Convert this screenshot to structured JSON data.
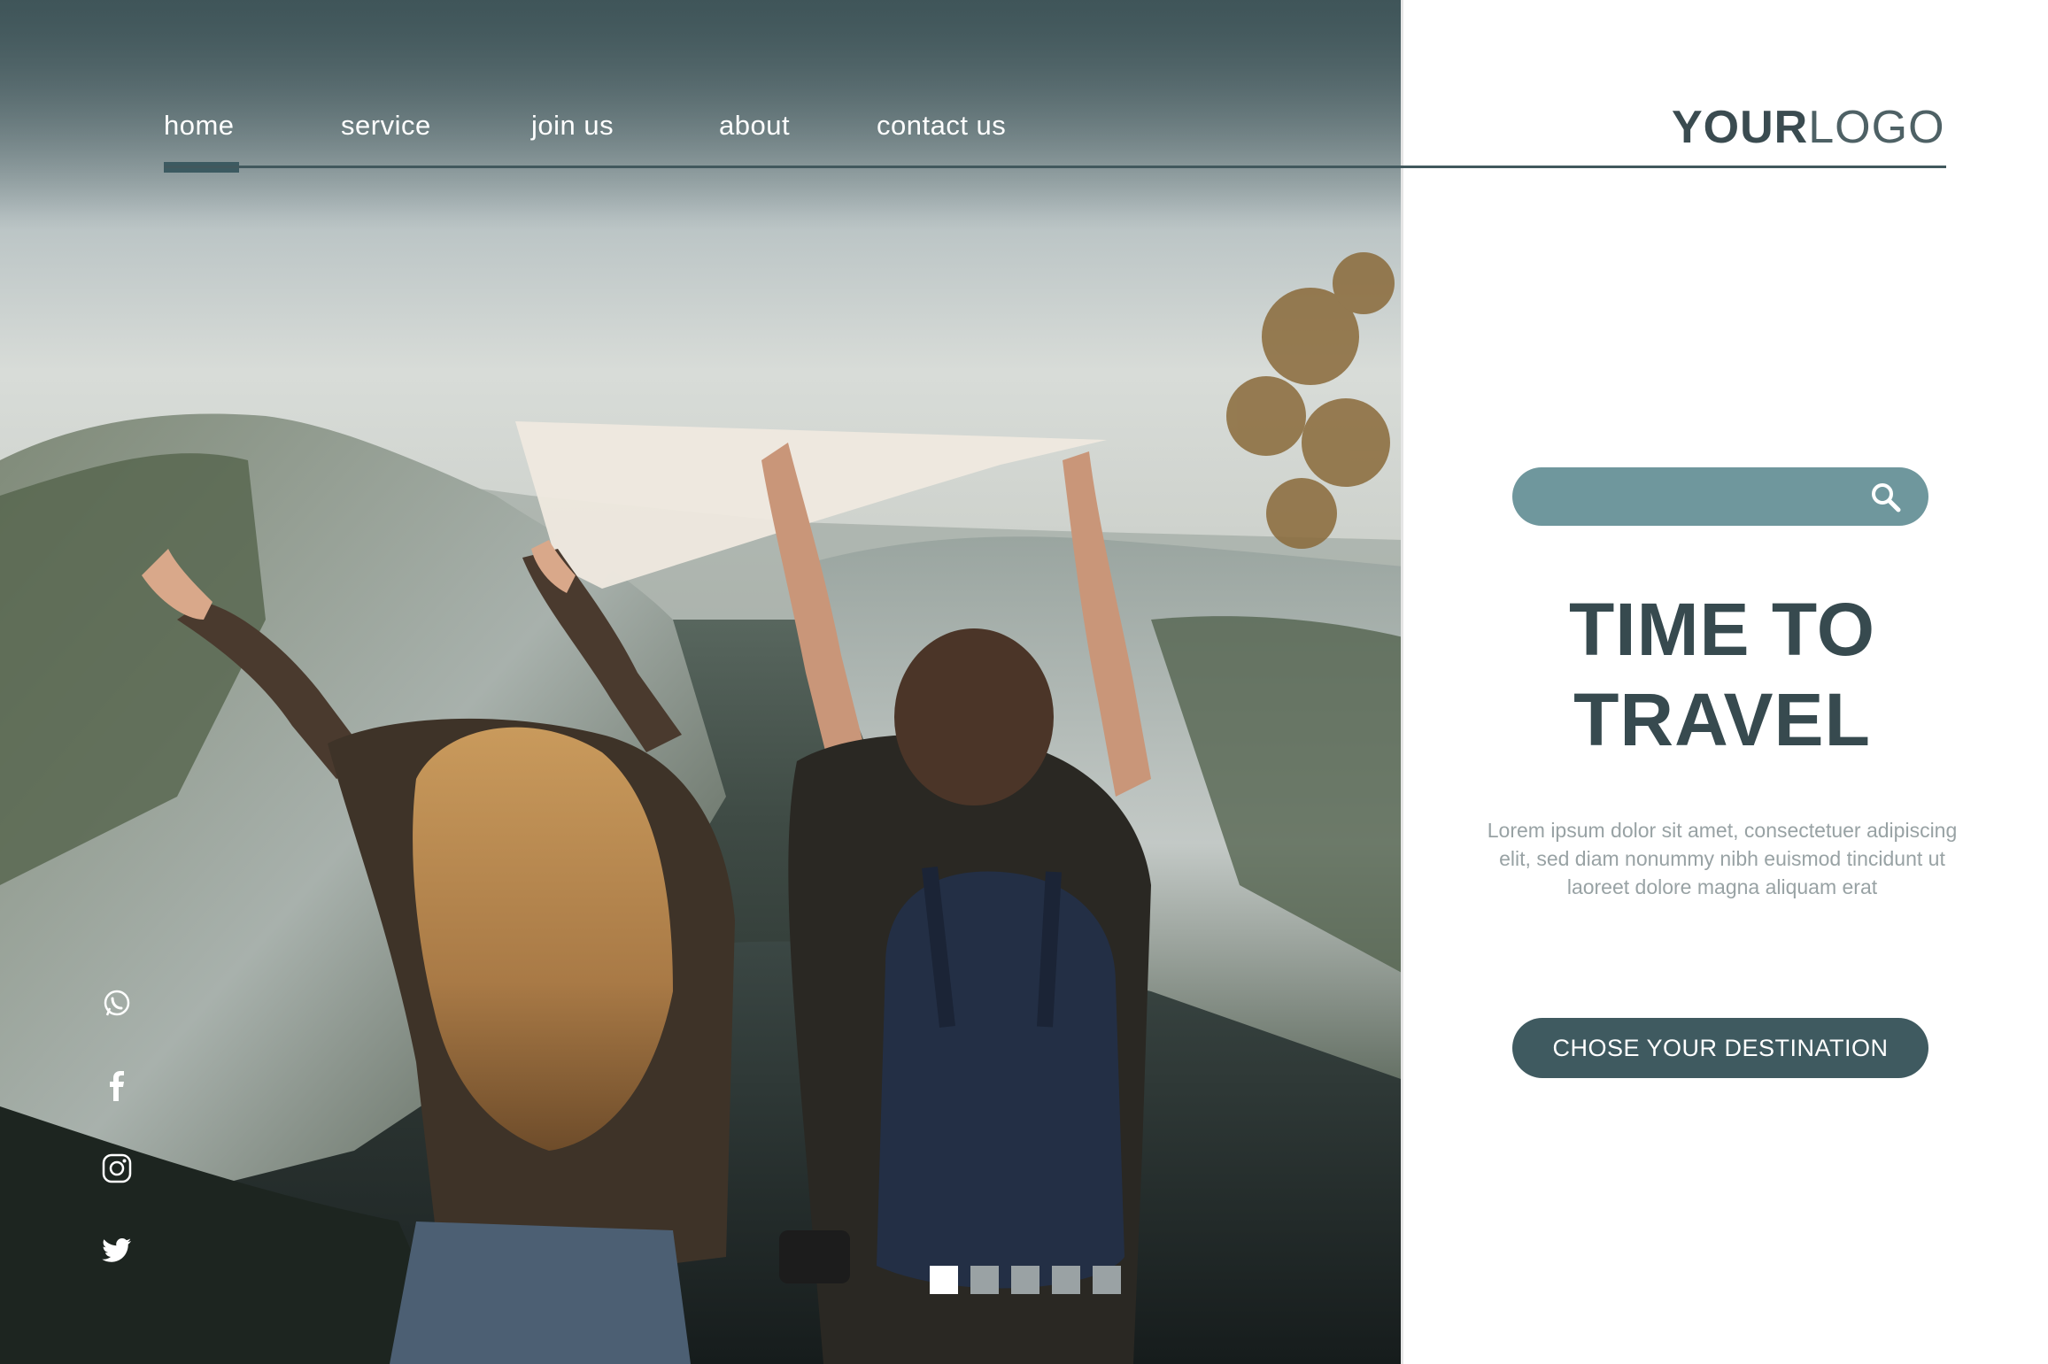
{
  "nav": {
    "items": [
      {
        "label": "home",
        "active": true
      },
      {
        "label": "service",
        "active": false
      },
      {
        "label": "join us",
        "active": false
      },
      {
        "label": "about",
        "active": false
      },
      {
        "label": "contact us",
        "active": false
      }
    ]
  },
  "logo": {
    "bold": "YOUR",
    "light": "LOGO"
  },
  "search": {
    "placeholder": "",
    "value": ""
  },
  "headline": {
    "line1": "TIME TO",
    "line2": "TRAVEL"
  },
  "body_text": "Lorem ipsum dolor sit amet, consectetuer adipiscing elit, sed diam nonummy nibh euismod tincidunt ut laoreet dolore magna aliquam erat",
  "cta": {
    "label": "CHOSE YOUR DESTINATION"
  },
  "social": [
    "whatsapp-icon",
    "facebook-icon",
    "instagram-icon",
    "twitter-icon"
  ],
  "slider": {
    "count": 5,
    "active_index": 0
  },
  "colors": {
    "accent_dark": "#3f5a60",
    "accent_light": "#6f979d",
    "headline": "#374a4f"
  }
}
